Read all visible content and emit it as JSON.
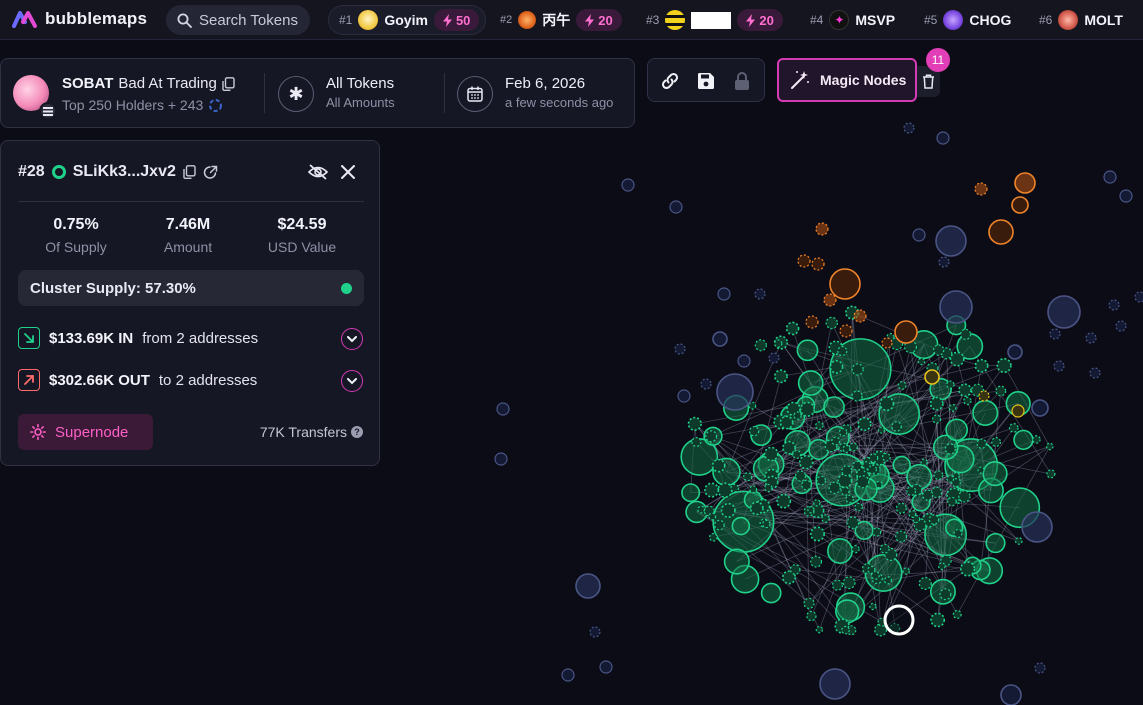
{
  "brand": {
    "name": "bubblemaps"
  },
  "search": {
    "placeholder": "Search Tokens"
  },
  "trending": [
    {
      "rank": "#1",
      "symbol": "Goyim",
      "boost": "50"
    },
    {
      "rank": "#2",
      "symbol": "丙午",
      "boost": "20"
    },
    {
      "rank": "#3",
      "symbol": "",
      "boost": "20"
    },
    {
      "rank": "#4",
      "symbol": "MSVP"
    },
    {
      "rank": "#5",
      "symbol": "CHOG"
    },
    {
      "rank": "#6",
      "symbol": "MOLT"
    }
  ],
  "token": {
    "name": "SOBAT",
    "tagline": "Bad At Trading",
    "holders_text": "Top 250 Holders + 243"
  },
  "filter": {
    "title": "All Tokens",
    "subtitle": "All Amounts"
  },
  "snapshot": {
    "date": "Feb 6, 2026",
    "relative": "a few seconds ago"
  },
  "magic_nodes": {
    "label": "Magic Nodes",
    "count": "11"
  },
  "wallet": {
    "rank": "#28",
    "address": "SLiKk3...Jxv2",
    "stats": [
      {
        "value": "0.75%",
        "label": "Of Supply"
      },
      {
        "value": "7.46M",
        "label": "Amount"
      },
      {
        "value": "$24.59",
        "label": "USD Value"
      }
    ],
    "cluster_supply": "Cluster Supply: 57.30%",
    "inflow": {
      "amount": "$133.69K IN",
      "text": "from 2 addresses"
    },
    "outflow": {
      "amount": "$302.66K OUT",
      "text": "to 2 addresses"
    },
    "supernode_label": "Supernode",
    "transfers": "77K Transfers"
  },
  "colors": {
    "background": "#0b0c16",
    "accent": "#d43cb4",
    "cluster_green": "#1fd18a",
    "orange": "#f0842a",
    "yellow": "#e8c21c",
    "blue_node": "#2b3354"
  }
}
